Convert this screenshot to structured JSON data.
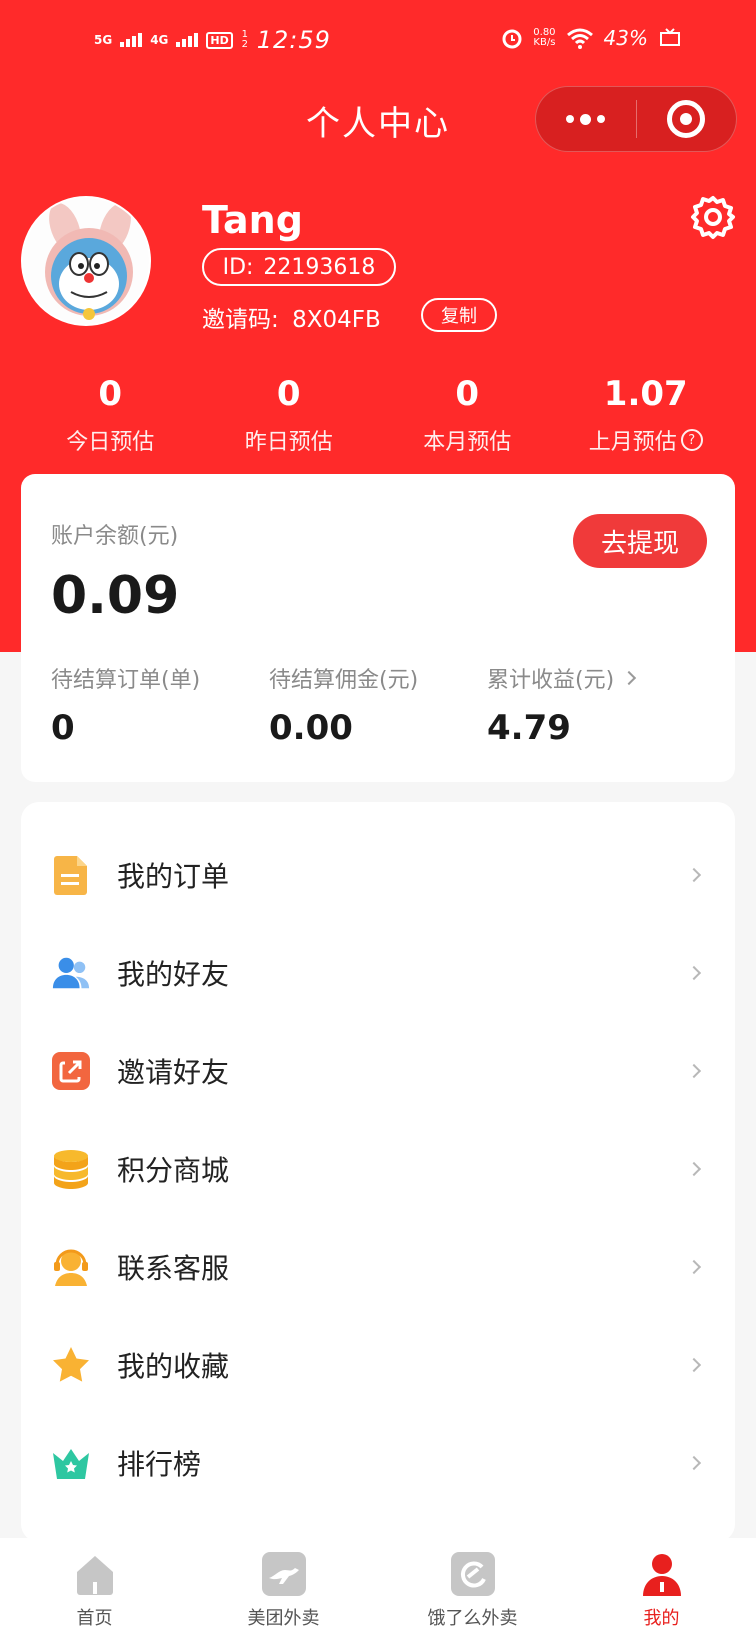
{
  "statusbar": {
    "signal1": "5G",
    "signal2": "4G",
    "hd": "HD",
    "hd_sub": "1 2",
    "time": "12:59",
    "speed_value": "0.80",
    "speed_unit": "KB/s",
    "battery": "43%"
  },
  "nav": {
    "title": "个人中心"
  },
  "profile": {
    "name": "Tang",
    "id_prefix": "ID:",
    "id": "22193618",
    "invite_label": "邀请码:",
    "invite_code": "8X04FB",
    "copy_label": "复制"
  },
  "stats": [
    {
      "value": "0",
      "label": "今日预估"
    },
    {
      "value": "0",
      "label": "昨日预估"
    },
    {
      "value": "0",
      "label": "本月预估"
    },
    {
      "value": "1.07",
      "label": "上月预估",
      "help": "?"
    }
  ],
  "balance": {
    "label": "账户余额(元)",
    "value": "0.09",
    "withdraw_label": "去提现",
    "items": [
      {
        "label": "待结算订单(单)",
        "value": "0"
      },
      {
        "label": "待结算佣金(元)",
        "value": "0.00"
      },
      {
        "label": "累计收益(元)",
        "value": "4.79"
      }
    ]
  },
  "menu": [
    {
      "label": "我的订单",
      "icon": "document-icon"
    },
    {
      "label": "我的好友",
      "icon": "friends-icon"
    },
    {
      "label": "邀请好友",
      "icon": "invite-icon"
    },
    {
      "label": "积分商城",
      "icon": "coins-icon"
    },
    {
      "label": "联系客服",
      "icon": "customer-service-icon"
    },
    {
      "label": "我的收藏",
      "icon": "star-icon"
    },
    {
      "label": "排行榜",
      "icon": "crown-icon"
    }
  ],
  "tabs": [
    {
      "label": "首页",
      "icon": "home-icon"
    },
    {
      "label": "美团外卖",
      "icon": "meituan-icon"
    },
    {
      "label": "饿了么外卖",
      "icon": "eleme-icon"
    },
    {
      "label": "我的",
      "icon": "user-icon",
      "active": true
    }
  ],
  "colors": {
    "brand_red": "#ff2a2a",
    "button_red": "#f03a3a",
    "active_tab": "#e8201e"
  }
}
